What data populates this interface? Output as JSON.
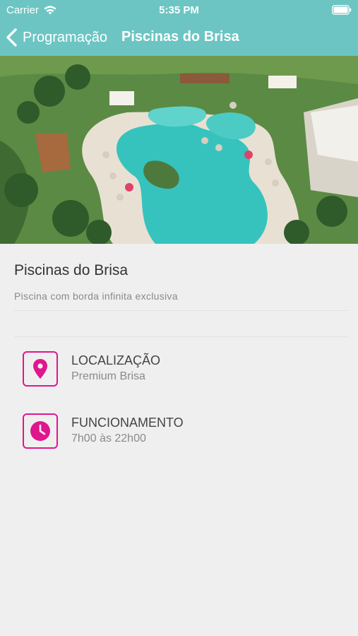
{
  "status_bar": {
    "carrier": "Carrier",
    "time": "5:35 PM"
  },
  "nav": {
    "back_label": "Programação",
    "title": "Piscinas do Brisa"
  },
  "hero_image": {
    "subject": "pool"
  },
  "detail": {
    "title": "Piscinas do Brisa",
    "subtitle": "Piscina com borda infinita exclusiva"
  },
  "info": [
    {
      "icon": "location-pin-icon",
      "label": "LOCALIZAÇÃO",
      "value": "Premium Brisa"
    },
    {
      "icon": "clock-icon",
      "label": "FUNCIONAMENTO",
      "value": "7h00 às 22h00"
    }
  ],
  "colors": {
    "header": "#6cc5c3",
    "accent": "#e0168f",
    "background": "#efefef"
  }
}
